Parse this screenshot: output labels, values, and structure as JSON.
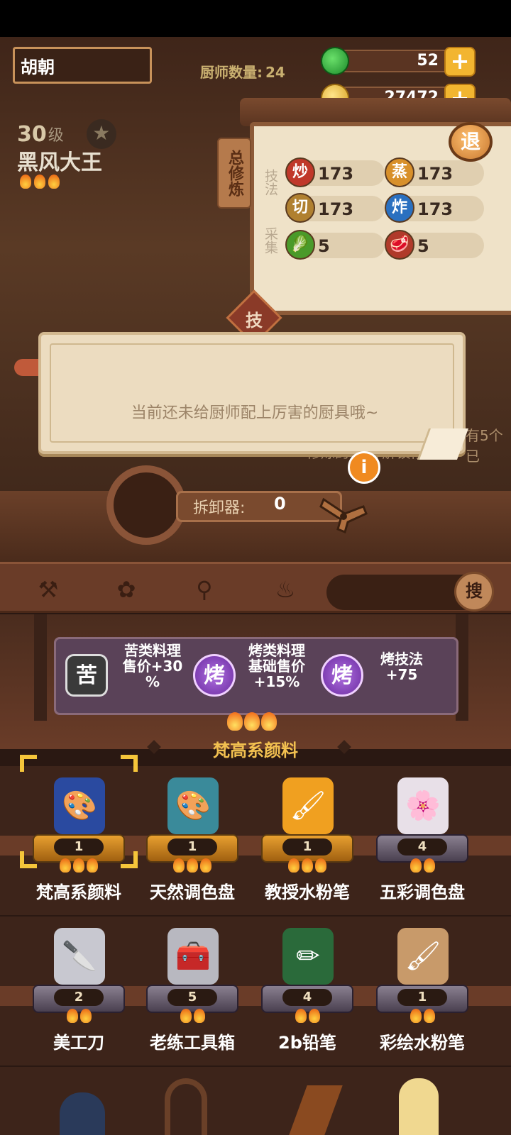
{
  "player": {
    "name": "胡朝"
  },
  "header": {
    "chef_count_label": "厨师数量:",
    "chef_count": "24"
  },
  "resources": {
    "jade": {
      "value": "52",
      "icon": "jade-icon",
      "plus": "+"
    },
    "coin": {
      "value": "27472",
      "icon": "coin-icon",
      "plus": "+"
    }
  },
  "chef": {
    "level": "30",
    "level_unit": "级",
    "name": "黑风大王",
    "star": "★"
  },
  "training": {
    "label": "总修炼",
    "exit": "退",
    "cat_skill": "技法",
    "cat_gather": "采集",
    "skills": [
      {
        "icon": "炒",
        "value": "173",
        "color": "#c0382a"
      },
      {
        "icon": "蒸",
        "value": "173",
        "color": "#d8902a"
      },
      {
        "icon": "切",
        "value": "173",
        "color": "#b08030"
      },
      {
        "icon": "炸",
        "value": "173",
        "color": "#2a70c0"
      }
    ],
    "gathers": [
      {
        "icon": "vegetable-icon",
        "value": "5"
      },
      {
        "icon": "meat-icon",
        "value": "5"
      }
    ],
    "tab": "技"
  },
  "notice": {
    "text": "当前还未给厨师配上厉害的厨具哦~",
    "bg_line1": "有5个已",
    "bg_line2": "修炼的    厨师解锁修炼"
  },
  "dismantle": {
    "label": "拆卸器:",
    "value": "0",
    "info": "i"
  },
  "toolbar": {
    "search_label": "搜"
  },
  "bonuses": [
    {
      "icon": "苦",
      "text_l1": "苦类料理",
      "text_l2": "售价+30",
      "text_l3": "%"
    },
    {
      "icon": "烤",
      "text_l1": "烤类料理",
      "text_l2": "基础售价",
      "text_l3": "+15%"
    },
    {
      "icon": "烤",
      "text_l1": "烤技法",
      "text_l2": "+75",
      "text_l3": ""
    }
  ],
  "selected_item": "梵高系颜料",
  "items": [
    {
      "name": "梵高系颜料",
      "count": "1",
      "stars": 3,
      "tier": "gold",
      "icon": "paint-tube-icon"
    },
    {
      "name": "天然调色盘",
      "count": "1",
      "stars": 3,
      "tier": "gold",
      "icon": "palette-icon"
    },
    {
      "name": "教授水粉笔",
      "count": "1",
      "stars": 3,
      "tier": "gold",
      "icon": "brush-gourd-icon"
    },
    {
      "name": "五彩调色盘",
      "count": "4",
      "stars": 2,
      "tier": "silver",
      "icon": "color-tray-icon"
    },
    {
      "name": "美工刀",
      "count": "2",
      "stars": 2,
      "tier": "silver",
      "icon": "utility-knife-icon"
    },
    {
      "name": "老练工具箱",
      "count": "5",
      "stars": 2,
      "tier": "silver",
      "icon": "toolbox-icon"
    },
    {
      "name": "2b铅笔",
      "count": "4",
      "stars": 2,
      "tier": "silver",
      "icon": "pencil-icon"
    },
    {
      "name": "彩绘水粉笔",
      "count": "1",
      "stars": 2,
      "tier": "silver",
      "icon": "paintbrush-icon"
    }
  ]
}
